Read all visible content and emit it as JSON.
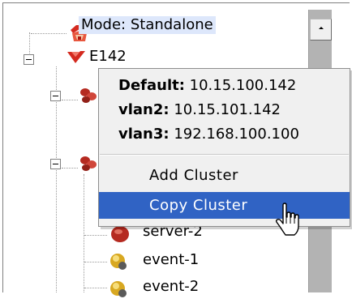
{
  "tree": {
    "mode_label": "Mode: Standalone",
    "root_label": "E142",
    "nodes": [
      {
        "label": "server-2",
        "icon": "server-icon"
      },
      {
        "label": "event-1",
        "icon": "event-icon"
      },
      {
        "label": "event-2",
        "icon": "event-icon"
      }
    ]
  },
  "popup": {
    "info": [
      {
        "key": "Default:",
        "value": " 10.15.100.142"
      },
      {
        "key": "vlan2:",
        "value": " 10.15.101.142"
      },
      {
        "key": "vlan3:",
        "value": " 192.168.100.100"
      }
    ],
    "items": [
      {
        "label": "Add Cluster",
        "highlighted": false
      },
      {
        "label": "Copy Cluster",
        "highlighted": true
      }
    ]
  },
  "colors": {
    "selection": "#3063c4",
    "mode_highlight": "#dde7fb",
    "scrollbar": "#b3b3b3",
    "menu_bg": "#f0f0f0"
  }
}
